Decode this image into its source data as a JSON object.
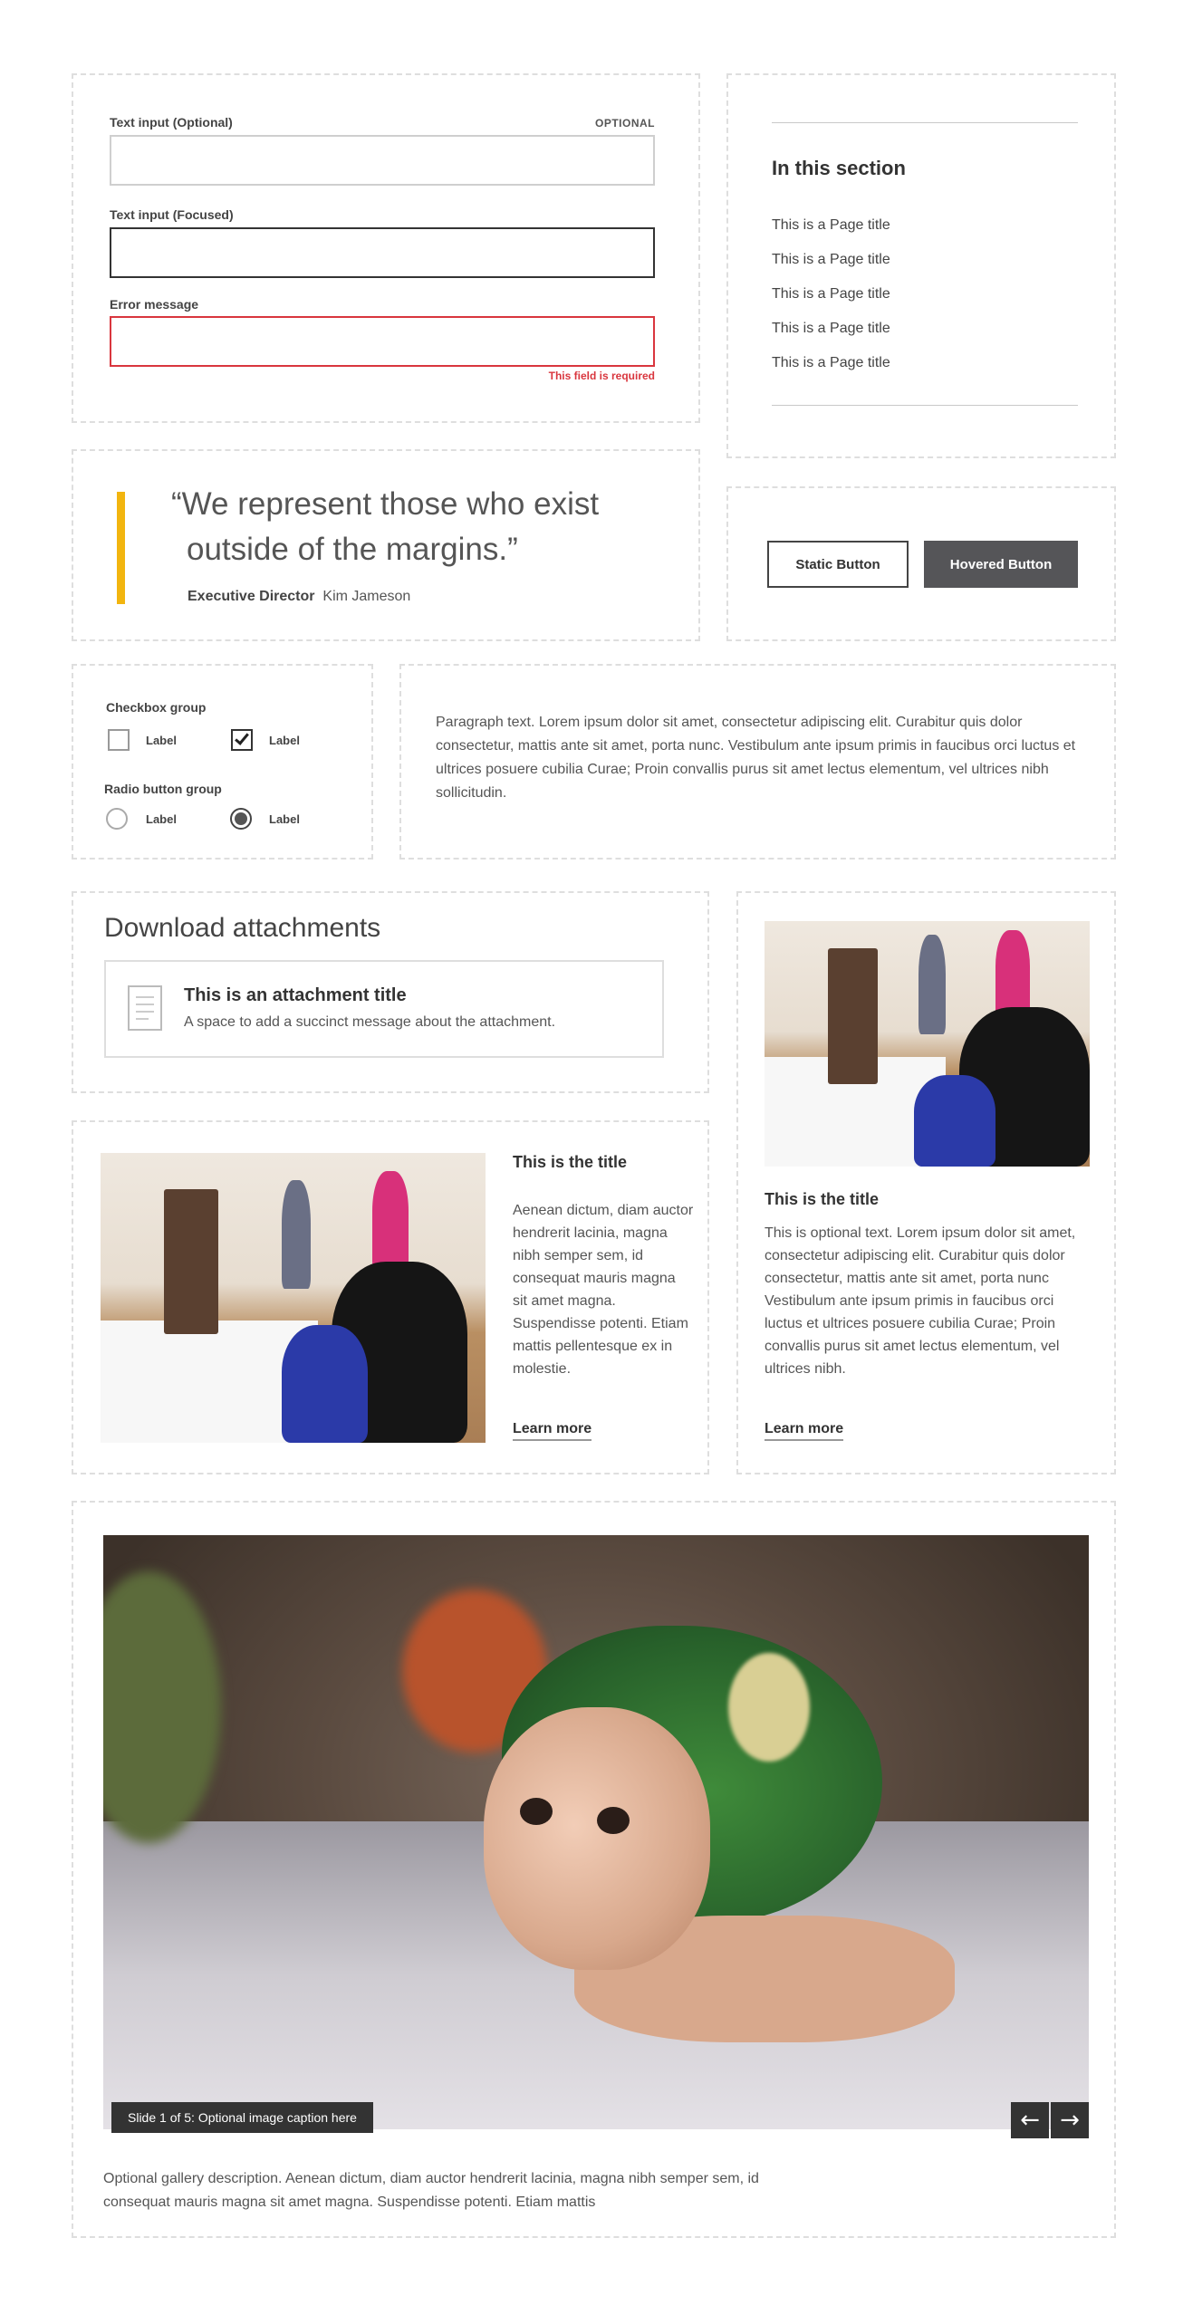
{
  "form": {
    "optional_label": "Text input (Optional)",
    "optional_tag": "OPTIONAL",
    "focused_label": "Text input (Focused)",
    "error_label": "Error message",
    "error_text": "This field is required"
  },
  "section_nav": {
    "title": "In this section",
    "items": [
      "This is a Page title",
      "This is a Page title",
      "This is a Page title",
      "This is a Page title",
      "This is a Page title"
    ]
  },
  "quote": {
    "line1": "“We represent those who exist",
    "line2": "outside of the margins.”",
    "role": "Executive Director",
    "name": "Kim Jameson",
    "accent_color": "#f2b50f"
  },
  "buttons": {
    "static_label": "Static Button",
    "hovered_label": "Hovered Button"
  },
  "checkbox_group": {
    "title": "Checkbox group",
    "options": [
      {
        "label": "Label",
        "checked": false
      },
      {
        "label": "Label",
        "checked": true
      }
    ]
  },
  "radio_group": {
    "title": "Radio button group",
    "options": [
      {
        "label": "Label",
        "selected": false
      },
      {
        "label": "Label",
        "selected": true
      }
    ]
  },
  "paragraph": {
    "text": "Paragraph text. Lorem ipsum dolor sit amet, consectetur adipiscing elit. Curabitur quis dolor consectetur, mattis ante sit amet, porta nunc. Vestibulum ante ipsum primis in faucibus orci luctus et ultrices posuere cubilia Curae; Proin convallis purus sit amet lectus elementum, vel ultrices nibh sollicitudin."
  },
  "downloads": {
    "title": "Download attachments",
    "attachment_title": "This is an attachment title",
    "attachment_desc": "A space to add a succinct message about the attachment."
  },
  "card_horizontal": {
    "title": "This is the title",
    "text": "Aenean dictum, diam auctor hendrerit lacinia, magna nibh semper sem, id consequat mauris magna sit amet magna. Suspendisse potenti. Etiam mattis pellentesque ex in molestie.",
    "link": "Learn more"
  },
  "card_vertical": {
    "title": "This is the title",
    "text": "This is optional text.  Lorem ipsum dolor sit amet, consectetur adipiscing elit. Curabitur quis dolor consectetur, mattis ante sit amet, porta nunc Vestibulum ante ipsum primis in faucibus orci luctus et ultrices posuere cubilia Curae; Proin convallis purus sit amet lectus elementum, vel ultrices nibh.",
    "link": "Learn more"
  },
  "gallery": {
    "caption": "Slide 1 of 5: Optional image caption here",
    "prev_icon": "←",
    "next_icon": "→",
    "description": "Optional gallery description. Aenean dictum, diam auctor hendrerit lacinia, magna nibh semper sem, id consequat mauris magna sit amet magna. Suspendisse potenti. Etiam mattis"
  },
  "colors": {
    "error": "#d9363e",
    "dark_button": "#555558",
    "border_dashed": "#dedede"
  }
}
